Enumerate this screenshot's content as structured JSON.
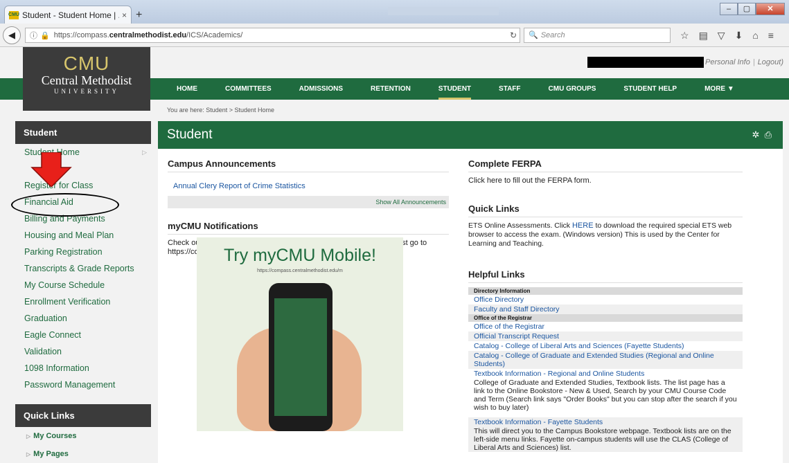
{
  "browser": {
    "tab_title": "Student - Student Home | ...",
    "tab_close": "×",
    "new_tab": "+",
    "favicon_text": "CMU",
    "url_prefix": "https://compass.",
    "url_domain": "centralmethodist.edu",
    "url_path": "/ICS/Academics/",
    "search_placeholder": "Search"
  },
  "header": {
    "logo_cmu": "CMU",
    "logo_name": "Central Methodist",
    "logo_univ": "UNIVERSITY",
    "personal_info": "Personal Info",
    "logout": "Logout",
    "close_paren": ")"
  },
  "nav": {
    "items": [
      "HOME",
      "COMMITTEES",
      "ADMISSIONS",
      "RETENTION",
      "STUDENT",
      "STAFF",
      "CMU GROUPS",
      "STUDENT HELP",
      "MORE ▼"
    ],
    "active": "STUDENT"
  },
  "breadcrumb": "You are here:  Student > Student Home",
  "sidebar": {
    "heading": "Student",
    "items": [
      "Student Home",
      "Register for Class",
      "Financial Aid",
      "Billing and Payments",
      "Housing and Meal Plan",
      "Parking Registration",
      "Transcripts & Grade Reports",
      "My Course Schedule",
      "Enrollment Verification",
      "Graduation",
      "Eagle Connect",
      "Validation",
      "1098 Information",
      "Password Management"
    ],
    "quick_heading": "Quick Links",
    "quick_items": [
      "My Courses",
      "My Pages"
    ]
  },
  "main": {
    "title": "Student",
    "campus_announcements": {
      "heading": "Campus Announcements",
      "item": "Annual Clery Report of Crime Statistics",
      "show_all": "Show All Announcements"
    },
    "notifications": {
      "heading": "myCMU Notifications",
      "text": "Check out the mobile version of myCMU! From your mobile device, just go to",
      "url": "https://compass.centralmethodist.edu/m",
      "promo_title": "Try myCMU Mobile!",
      "promo_url": "https://compass.centralmethodist.edu/m"
    },
    "ferpa": {
      "heading": "Complete FERPA",
      "link": "Click here to fill out the FERPA form."
    },
    "quick_links": {
      "heading": "Quick Links",
      "text_before": "ETS Online Assessments. Click ",
      "here": "HERE",
      "text_after": " to download the required special ETS web browser to access the exam. (Windows version) This is used by the Center for Learning and Teaching."
    },
    "helpful_links": {
      "heading": "Helpful Links",
      "dir_header": "Directory Information",
      "office_directory": "Office Directory",
      "faculty_directory": "Faculty and Staff Directory",
      "registrar_header": "Office of the Registrar",
      "registrar": "Office of the Registrar",
      "transcript": "Official Transcript Request",
      "catalog_las": "Catalog - College of Liberal Arts and Sciences (Fayette Students)",
      "catalog_grad": "Catalog - College of Graduate and Extended Studies (Regional and Online Students)",
      "textbook_regional": "Textbook Information - Regional and Online Students",
      "textbook_regional_desc": "College of Graduate and Extended Studies, Textbook lists. The list page has a link to the Online Bookstore - New & Used, Search by your CMU Course Code and Term (Search link says \"Order Books\" but you can stop after the search if you wish to buy later)",
      "textbook_fayette": "Textbook Information - Fayette Students",
      "textbook_fayette_desc": "This will direct you to the Campus Bookstore webpage. Textbook lists are on the left-side menu links. Fayette on-campus students will use the CLAS (College of Liberal Arts and Sciences) list."
    }
  },
  "colors": {
    "green": "#1f6b3f",
    "gold": "#d7c56c",
    "dark": "#3b3b3b",
    "link": "#1a55a0",
    "annotation_red": "#e8201a"
  }
}
